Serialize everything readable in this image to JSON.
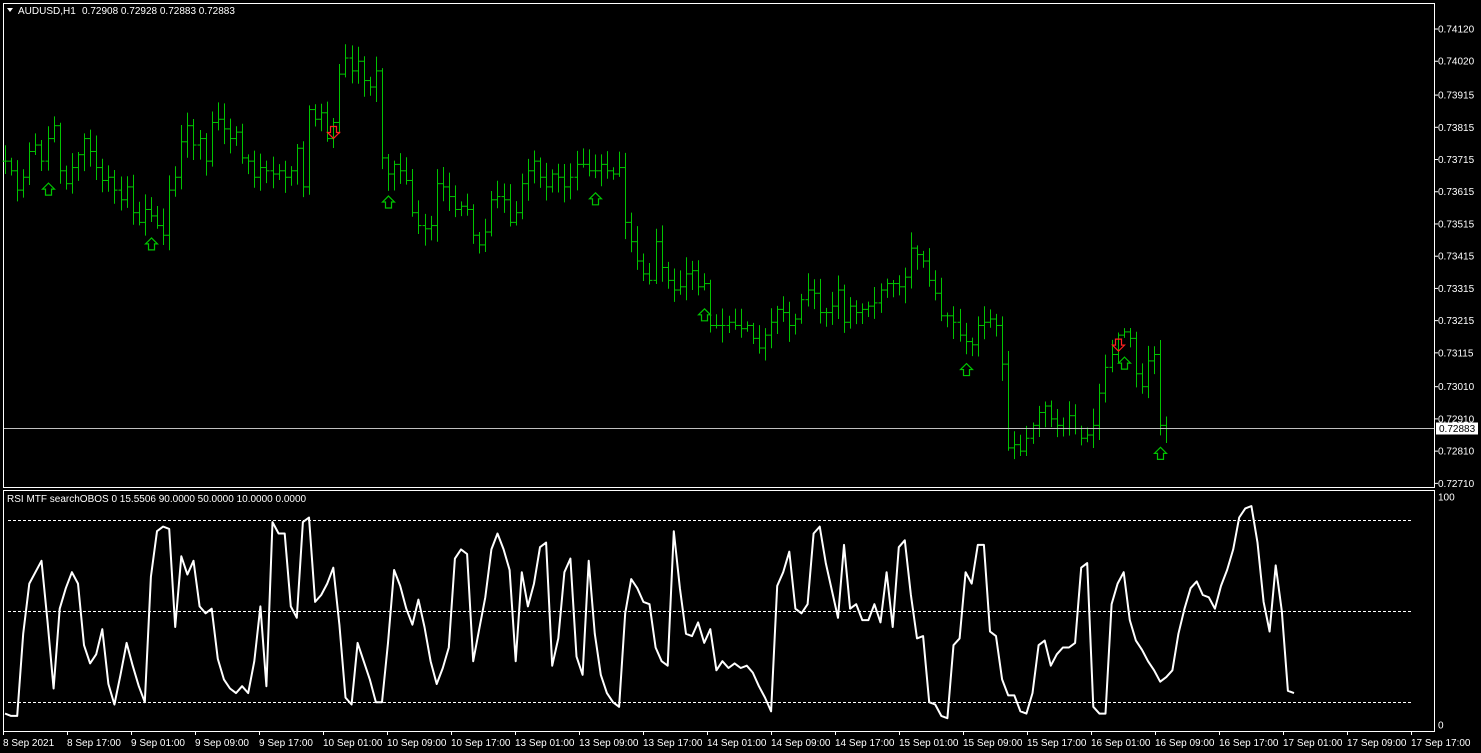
{
  "colors": {
    "background": "#000000",
    "frame": "#ffffff",
    "bar": "#00c400",
    "arrow_up": "#00c400",
    "arrow_down": "#ff2020",
    "rsi_line": "#ffffff",
    "price_line": "#c0c0c0",
    "level_line": "#ffffff"
  },
  "price_header": {
    "symbol": "AUDUSD,H1",
    "ohlc": "0.72908 0.72928 0.72883 0.72883"
  },
  "rsi_header": {
    "text": "RSI MTF searchOBOS 0 15.5506 90.0000 50.0000 10.0000 0.0000"
  },
  "chart_data": [
    {
      "type": "ohlc-bar",
      "name": "AUDUSD,H1",
      "ylim": [
        0.72708,
        0.74148
      ],
      "y_ticks": [
        "0.74120",
        "0.74020",
        "0.73915",
        "0.73815",
        "0.73715",
        "0.73615",
        "0.73515",
        "0.73415",
        "0.73315",
        "0.73215",
        "0.73115",
        "0.73010",
        "0.72910",
        "0.72810",
        "0.72710"
      ],
      "current_price_label": "0.72883",
      "current_price": 0.72883,
      "x_labels": [
        "8 Sep 2021",
        "8 Sep 17:00",
        "9 Sep 01:00",
        "9 Sep 09:00",
        "9 Sep 17:00",
        "10 Sep 01:00",
        "10 Sep 09:00",
        "10 Sep 17:00",
        "13 Sep 01:00",
        "13 Sep 09:00",
        "13 Sep 17:00",
        "14 Sep 01:00",
        "14 Sep 09:00",
        "14 Sep 17:00",
        "15 Sep 01:00",
        "15 Sep 09:00",
        "15 Sep 17:00",
        "16 Sep 01:00",
        "16 Sep 09:00",
        "16 Sep 17:00",
        "17 Sep 01:00",
        "17 Sep 09:00",
        "17 Sep 17:00"
      ],
      "closes": [
        0.7371,
        0.7368,
        0.7362,
        0.7366,
        0.7374,
        0.7376,
        0.7371,
        0.7378,
        0.7382,
        0.7368,
        0.7364,
        0.7369,
        0.7373,
        0.7378,
        0.7374,
        0.7369,
        0.7365,
        0.7366,
        0.7362,
        0.7359,
        0.7363,
        0.7355,
        0.7352,
        0.7356,
        0.7354,
        0.7351,
        0.7348,
        0.7362,
        0.7366,
        0.7377,
        0.7382,
        0.7376,
        0.7378,
        0.7371,
        0.7383,
        0.7384,
        0.7381,
        0.7378,
        0.738,
        0.7372,
        0.7371,
        0.7366,
        0.7369,
        0.7368,
        0.7367,
        0.7368,
        0.7366,
        0.7368,
        0.7375,
        0.7363,
        0.7387,
        0.7384,
        0.7386,
        0.7378,
        0.7383,
        0.7398,
        0.7403,
        0.7399,
        0.7402,
        0.7396,
        0.7394,
        0.7399,
        0.7372,
        0.7367,
        0.737,
        0.7368,
        0.7365,
        0.7355,
        0.7351,
        0.735,
        0.7351,
        0.7364,
        0.7363,
        0.736,
        0.7356,
        0.7357,
        0.7356,
        0.7348,
        0.7345,
        0.7349,
        0.7359,
        0.736,
        0.7359,
        0.7352,
        0.7355,
        0.7364,
        0.7368,
        0.7371,
        0.7366,
        0.7363,
        0.7367,
        0.7366,
        0.7363,
        0.7366,
        0.737,
        0.737,
        0.7368,
        0.7368,
        0.737,
        0.7368,
        0.7367,
        0.7369,
        0.7352,
        0.7346,
        0.734,
        0.7336,
        0.7334,
        0.7346,
        0.7338,
        0.7334,
        0.7331,
        0.7332,
        0.7336,
        0.7337,
        0.7332,
        0.7333,
        0.732,
        0.732,
        0.732,
        0.7321,
        0.732,
        0.7319,
        0.732,
        0.7316,
        0.7313,
        0.7317,
        0.7321,
        0.7325,
        0.7324,
        0.732,
        0.7322,
        0.7328,
        0.7331,
        0.733,
        0.7324,
        0.7324,
        0.7326,
        0.7331,
        0.7321,
        0.7326,
        0.7324,
        0.7325,
        0.7326,
        0.7327,
        0.7331,
        0.7333,
        0.7333,
        0.7332,
        0.7335,
        0.7344,
        0.7342,
        0.734,
        0.7334,
        0.733,
        0.7323,
        0.7323,
        0.7321,
        0.7317,
        0.7315,
        0.7314,
        0.732,
        0.7321,
        0.7322,
        0.732,
        0.7308,
        0.7282,
        0.7283,
        0.7281,
        0.7285,
        0.7289,
        0.7293,
        0.7295,
        0.7291,
        0.7289,
        0.7288,
        0.7292,
        0.7288,
        0.7285,
        0.7286,
        0.7289,
        0.7299,
        0.7307,
        0.7311,
        0.7317,
        0.7318,
        0.7316,
        0.7305,
        0.7301,
        0.7309,
        0.7311,
        0.7289,
        0.7288
      ],
      "arrows_up_at": [
        7,
        24,
        63,
        97,
        115,
        158,
        184,
        190
      ],
      "arrows_down_at": [
        54,
        183
      ]
    },
    {
      "type": "line",
      "name": "RSI MTF searchOBOS",
      "ylim": [
        0,
        100
      ],
      "y_ticks": [
        "100",
        "0"
      ],
      "levels": [
        90,
        50,
        10
      ],
      "values": [
        5,
        4,
        4,
        40,
        62,
        67,
        72,
        45,
        16,
        51,
        60,
        67,
        62,
        35,
        27,
        31,
        42,
        18,
        9,
        22,
        36,
        26,
        17,
        10,
        65,
        85,
        87,
        86,
        43,
        74,
        66,
        72,
        52,
        49,
        51,
        29,
        20,
        16,
        14,
        17,
        14,
        28,
        52,
        17,
        89,
        84,
        84,
        52,
        47,
        89,
        91,
        54,
        57,
        62,
        69,
        44,
        12,
        9,
        36,
        28,
        20,
        10,
        10,
        36,
        68,
        61,
        51,
        44,
        55,
        43,
        28,
        18,
        25,
        34,
        73,
        77,
        75,
        28,
        42,
        56,
        77,
        84,
        77,
        68,
        28,
        67,
        52,
        62,
        78,
        80,
        26,
        38,
        67,
        73,
        30,
        22,
        72,
        40,
        22,
        14,
        10,
        8,
        49,
        64,
        60,
        54,
        53,
        34,
        28,
        26,
        85,
        60,
        40,
        39,
        45,
        36,
        42,
        24,
        28,
        25,
        27,
        25,
        26,
        23,
        17,
        12,
        6,
        61,
        67,
        76,
        51,
        49,
        53,
        84,
        87,
        71,
        59,
        47,
        79,
        51,
        53,
        46,
        46,
        53,
        45,
        67,
        43,
        78,
        81,
        57,
        38,
        39,
        10,
        9,
        4,
        3,
        35,
        38,
        67,
        62,
        79,
        79,
        41,
        39,
        20,
        13,
        13,
        6,
        5,
        14,
        35,
        37,
        26,
        31,
        34,
        34,
        36,
        69,
        71,
        8,
        5,
        5,
        53,
        62,
        67,
        46,
        37,
        33,
        28,
        24,
        19,
        21,
        24,
        40,
        51,
        60,
        63,
        57,
        56,
        51,
        61,
        68,
        77,
        91,
        95,
        96,
        80,
        54,
        41,
        70,
        50,
        15,
        14
      ],
      "x_labels": [
        "8 Sep 2021",
        "8 Sep 17:00",
        "9 Sep 01:00",
        "9 Sep 09:00",
        "9 Sep 17:00",
        "10 Sep 01:00",
        "10 Sep 09:00",
        "10 Sep 17:00",
        "13 Sep 01:00",
        "13 Sep 09:00",
        "13 Sep 17:00",
        "14 Sep 01:00",
        "14 Sep 09:00",
        "14 Sep 17:00",
        "15 Sep 01:00",
        "15 Sep 09:00",
        "15 Sep 17:00",
        "16 Sep 01:00",
        "16 Sep 09:00",
        "16 Sep 17:00",
        "17 Sep 01:00",
        "17 Sep 09:00",
        "17 Sep 17:00"
      ]
    }
  ]
}
